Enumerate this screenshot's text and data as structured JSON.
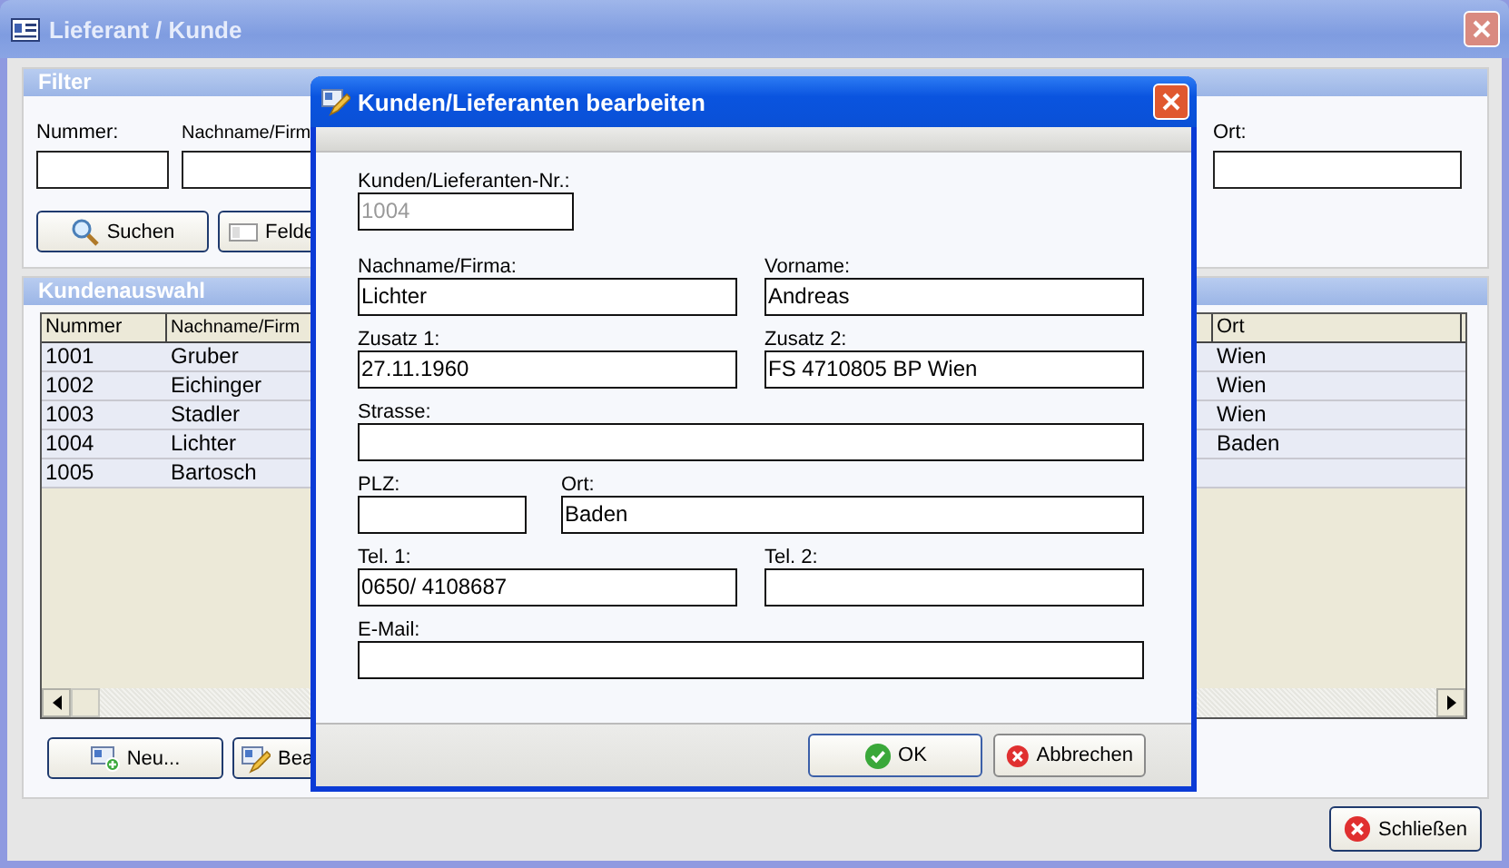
{
  "window": {
    "title": "Lieferant / Kunde"
  },
  "filter": {
    "title": "Filter",
    "fields": [
      {
        "label": "Nummer:"
      },
      {
        "label": "Nachname/Firm"
      },
      {
        "label": "Ort:"
      }
    ],
    "buttons": [
      {
        "label": "Suchen",
        "kind": "search"
      },
      {
        "label": "Felde",
        "kind": "clear"
      }
    ]
  },
  "customers": {
    "title": "Kundenauswahl",
    "columns": [
      "Nummer",
      "Nachname/Firm",
      "Ort"
    ],
    "rows": [
      {
        "number": "1001",
        "name": "Gruber",
        "city": "Wien"
      },
      {
        "number": "1002",
        "name": "Eichinger",
        "city": "Wien"
      },
      {
        "number": "1003",
        "name": "Stadler",
        "city": "Wien"
      },
      {
        "number": "1004",
        "name": "Lichter",
        "city": "Baden"
      },
      {
        "number": "1005",
        "name": "Bartosch"
      }
    ],
    "buttons": [
      {
        "label": "Neu...",
        "kind": "new"
      },
      {
        "label": "Bea",
        "kind": "edit"
      }
    ]
  },
  "close_button": {
    "label": "Schließen",
    "kind": "cancel"
  },
  "dialog": {
    "title": "Kunden/Lieferanten bearbeiten",
    "rows": [
      {
        "fields": [
          {
            "label": "Kunden/Lieferanten-Nr.:",
            "value": "1004",
            "kind": "number",
            "disabled": true
          }
        ]
      },
      {
        "fields": [
          {
            "label": "Nachname/Firma:",
            "value": "Lichter",
            "kind": "half"
          },
          {
            "label": "Vorname:",
            "value": "Andreas",
            "kind": "half"
          }
        ]
      },
      {
        "fields": [
          {
            "label": "Zusatz 1:",
            "value": "27.11.1960",
            "kind": "half"
          },
          {
            "label": "Zusatz 2:",
            "value": "FS 4710805 BP Wien",
            "kind": "half"
          }
        ]
      },
      {
        "fields": [
          {
            "label": "Strasse:",
            "kind": "wide"
          }
        ]
      },
      {
        "fields": [
          {
            "label": "PLZ:",
            "kind": "zip"
          },
          {
            "label": "Ort:",
            "value": "Baden",
            "kind": "city"
          }
        ]
      },
      {
        "fields": [
          {
            "label": "Tel. 1:",
            "value": "0650/ 4108687",
            "kind": "half"
          },
          {
            "label": "Tel. 2:",
            "kind": "half"
          }
        ]
      },
      {
        "fields": [
          {
            "label": "E-Mail:",
            "kind": "wide"
          }
        ]
      }
    ],
    "buttons": [
      {
        "label": "OK",
        "kind": "ok"
      },
      {
        "label": "Abbrechen",
        "kind": "cancel"
      }
    ]
  }
}
